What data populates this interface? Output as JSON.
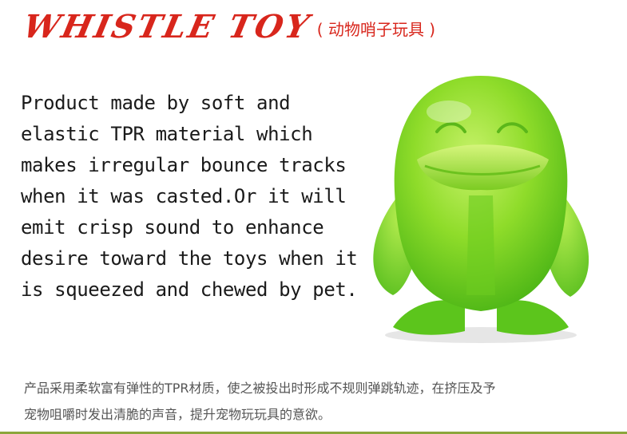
{
  "header": {
    "title": "WHISTLE TOY",
    "subtitle_cn": "( 动物哨子玩具 )"
  },
  "description_en": "Product made by soft and\nelastic TPR material which\nmakes irregular bounce tracks\nwhen it was casted.Or it will\nemit crisp sound to enhance\ndesire toward the toys when it\nis squeezed and chewed by pet.",
  "description_cn": "产品采用柔软富有弹性的TPR材质，使之被投出时形成不规则弹跳轨迹，在挤压及予\n宠物咀嚼时发出清脆的声音，提升宠物玩玩具的意欲。",
  "colors": {
    "title_red": "#d8261c",
    "toy_green": "#7ed321",
    "rule_green": "#8ca63c"
  }
}
